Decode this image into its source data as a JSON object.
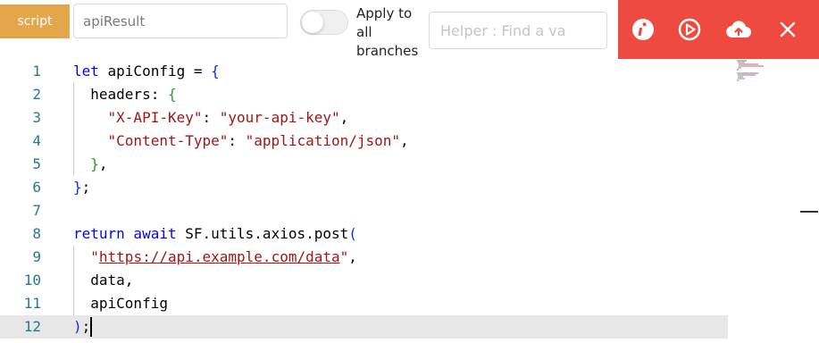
{
  "toolbar": {
    "script_label": "script",
    "result_name": "apiResult",
    "toggle_label": "Apply to all branches",
    "helper_placeholder": "Helper : Find a va",
    "colors": {
      "script_tag": "#e3a64a",
      "action_bar": "#ef4a3f"
    },
    "actions": [
      {
        "name": "info-icon"
      },
      {
        "name": "play-icon"
      },
      {
        "name": "upload-cloud-icon"
      },
      {
        "name": "close-icon"
      }
    ]
  },
  "editor": {
    "active_line": 12,
    "lines": [
      {
        "n": "1",
        "tokens": [
          {
            "t": "let ",
            "c": "kw"
          },
          {
            "t": "apiConfig = "
          },
          {
            "t": "{",
            "c": "b1"
          }
        ]
      },
      {
        "n": "2",
        "tokens": [
          {
            "t": "  headers: "
          },
          {
            "t": "{",
            "c": "b2"
          }
        ]
      },
      {
        "n": "3",
        "tokens": [
          {
            "t": "    "
          },
          {
            "t": "\"X-API-Key\"",
            "c": "str"
          },
          {
            "t": ": "
          },
          {
            "t": "\"your-api-key\"",
            "c": "str"
          },
          {
            "t": ","
          }
        ]
      },
      {
        "n": "4",
        "tokens": [
          {
            "t": "    "
          },
          {
            "t": "\"Content-Type\"",
            "c": "str"
          },
          {
            "t": ": "
          },
          {
            "t": "\"application/json\"",
            "c": "str"
          },
          {
            "t": ","
          }
        ]
      },
      {
        "n": "5",
        "tokens": [
          {
            "t": "  "
          },
          {
            "t": "}",
            "c": "b2"
          },
          {
            "t": ","
          }
        ]
      },
      {
        "n": "6",
        "tokens": [
          {
            "t": "}",
            "c": "b1"
          },
          {
            "t": ";"
          }
        ]
      },
      {
        "n": "7",
        "tokens": []
      },
      {
        "n": "8",
        "tokens": [
          {
            "t": "return await ",
            "c": "kw"
          },
          {
            "t": "SF.utils.axios.post"
          },
          {
            "t": "(",
            "c": "b1"
          }
        ]
      },
      {
        "n": "9",
        "tokens": [
          {
            "t": "  "
          },
          {
            "t": "\"",
            "c": "str"
          },
          {
            "t": "https://api.example.com/data",
            "c": "str url"
          },
          {
            "t": "\"",
            "c": "str"
          },
          {
            "t": ","
          }
        ]
      },
      {
        "n": "10",
        "tokens": [
          {
            "t": "  data,"
          }
        ]
      },
      {
        "n": "11",
        "tokens": [
          {
            "t": "  apiConfig"
          }
        ]
      },
      {
        "n": "12",
        "tokens": [
          {
            "t": ")",
            "c": "b1"
          },
          {
            "t": ";"
          }
        ]
      }
    ]
  }
}
